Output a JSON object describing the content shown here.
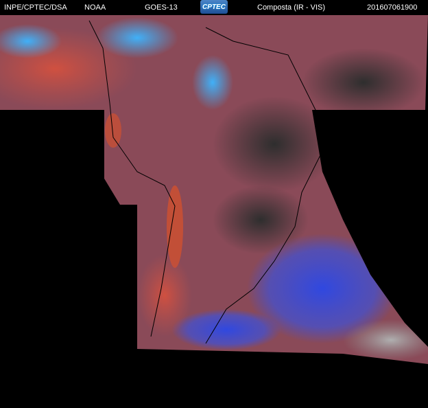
{
  "header": {
    "agency": "INPE/CPTEC/DSA",
    "source": "NOAA",
    "satellite": "GOES-13",
    "logo_text": "CPTEC",
    "product": "Composta (IR - VIS)",
    "timestamp": "201607061900"
  },
  "colors": {
    "background": "#000000",
    "land_base": "#3a3434",
    "warm_cloud": "#c0504a",
    "cold_cloud": "#3a5cd8",
    "high_cloud": "#4aa8f0",
    "low_cloud": "#9a9a9a"
  }
}
